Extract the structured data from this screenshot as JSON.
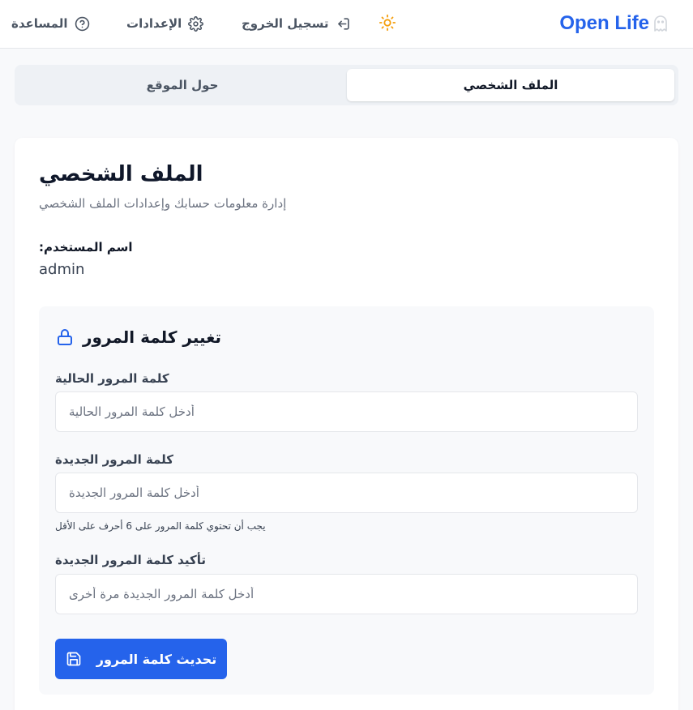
{
  "header": {
    "brand": "Open Life",
    "nav": {
      "help": "المساعدة",
      "settings": "الإعدادات",
      "logout": "تسجيل الخروج"
    },
    "icons": {
      "brand": "ghost-icon",
      "help": "help-circle-icon",
      "settings": "gear-icon",
      "logout": "logout-icon",
      "theme": "sun-icon"
    }
  },
  "tabs": [
    {
      "label": "الملف الشخصي",
      "active": true
    },
    {
      "label": "حول الموقع",
      "active": false
    }
  ],
  "profile": {
    "title": "الملف الشخصي",
    "subtitle": "إدارة معلومات حسابك وإعدادات الملف الشخصي",
    "username_label": "اسم المستخدم:",
    "username_value": "admin"
  },
  "password_form": {
    "heading": "تغيير كلمة المرور",
    "heading_icon": "lock-icon",
    "current": {
      "label": "كلمة المرور الحالية",
      "placeholder": "أدخل كلمة المرور الحالية",
      "value": ""
    },
    "new": {
      "label": "كلمة المرور الجديدة",
      "placeholder": "أدخل كلمة المرور الجديدة",
      "value": "",
      "hint": "يجب أن تحتوي كلمة المرور على 6 أحرف على الأقل"
    },
    "confirm": {
      "label": "تأكيد كلمة المرور الجديدة",
      "placeholder": "أدخل كلمة المرور الجديدة مرة أخرى",
      "value": ""
    },
    "submit_label": "تحديث كلمة المرور",
    "submit_icon": "save-icon"
  },
  "colors": {
    "accent": "#2563eb",
    "sun": "#f59e0b",
    "page_bg": "#f8f9fb"
  }
}
